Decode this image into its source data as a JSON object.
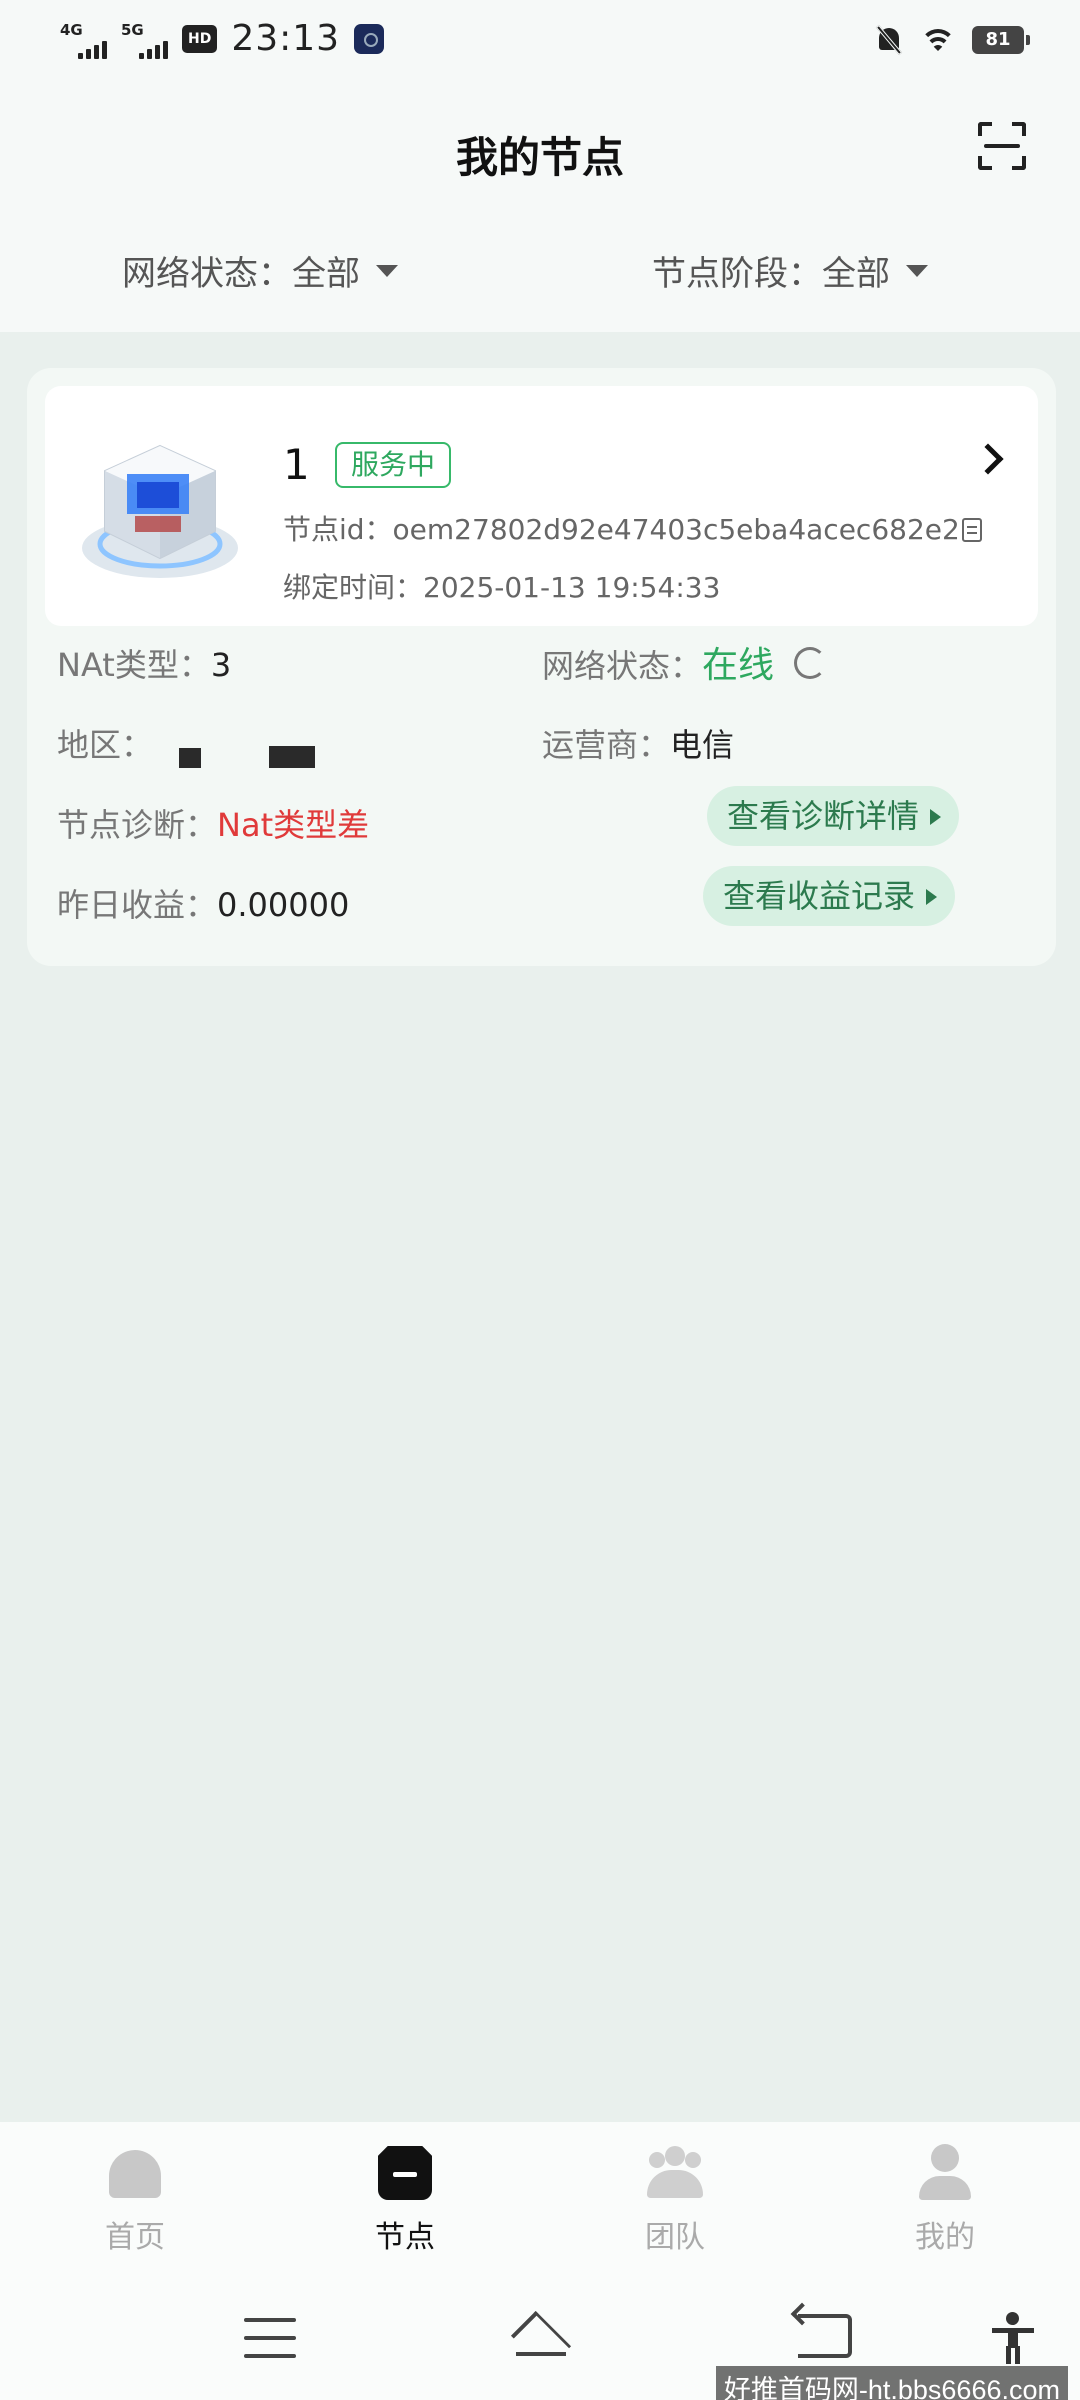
{
  "status_bar": {
    "signal_1": "4G",
    "signal_2": "5G",
    "hd": "HD",
    "time": "23:13",
    "battery": "81"
  },
  "header": {
    "title": "我的节点"
  },
  "filters": {
    "network_status": "网络状态：全部",
    "node_stage": "节点阶段：全部"
  },
  "node_card": {
    "name": "1",
    "status_badge": "服务中",
    "node_id": "节点id：oem27802d92e47403c5eba4acec682e2",
    "bind_time": "绑定时间：2025-01-13 19:54:33",
    "nat_label": "NAt类型：",
    "nat_value": "3",
    "net_label": "网络状态：",
    "net_value": "在线",
    "region_label": "地区：",
    "isp_label": "运营商：",
    "isp_value": "电信",
    "diag_label": "节点诊断：",
    "diag_value": "Nat类型差",
    "diag_button": "查看诊断详情",
    "earn_label": "昨日收益：",
    "earn_value": "0.00000",
    "earn_button": "查看收益记录",
    "accent_green": "#2ea85f",
    "alert_red": "#e03a3a"
  },
  "tabbar": {
    "items": [
      {
        "label": "首页",
        "icon": "home-icon"
      },
      {
        "label": "节点",
        "icon": "node-icon"
      },
      {
        "label": "团队",
        "icon": "team-icon"
      },
      {
        "label": "我的",
        "icon": "profile-icon"
      }
    ],
    "active": "节点"
  },
  "watermark": "好推首码网-ht.bbs6666.com"
}
